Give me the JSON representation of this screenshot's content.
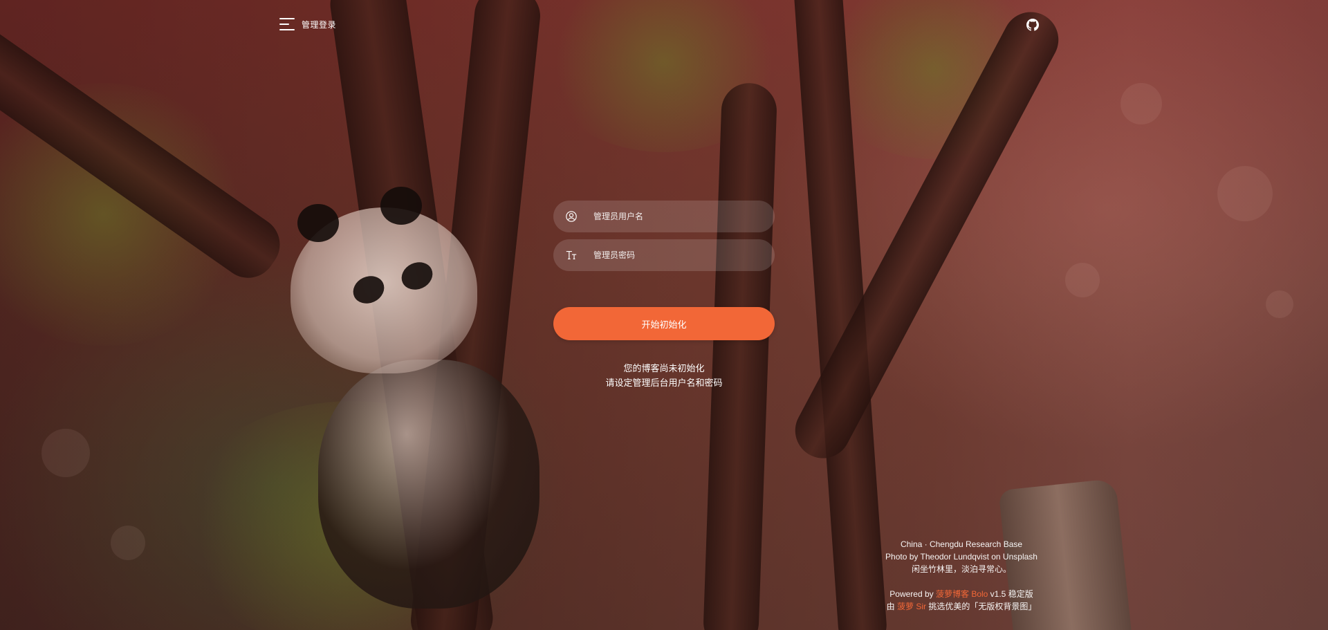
{
  "header": {
    "menu_label": "管理登录",
    "github_icon": "github-icon"
  },
  "form": {
    "username_placeholder": "管理员用户名",
    "password_placeholder": "管理员密码",
    "username_icon": "user-circle-icon",
    "password_icon": "text-tt-icon",
    "submit_label": "开始初始化",
    "notice_line1": "您的博客尚未初始化",
    "notice_line2": "请设定管理后台用户名和密码"
  },
  "footer": {
    "location": "China · Chengdu Research Base",
    "photo_credit": "Photo by Theodor Lundqvist on Unsplash",
    "motto": "闲坐竹林里，淡泊寻常心。",
    "powered_prefix": "Powered by ",
    "powered_link": "菠萝博客 Bolo",
    "powered_suffix": " v1.5 稳定版",
    "curated_prefix": "由 ",
    "curated_link": "菠萝 Sir",
    "curated_suffix": " 挑选优美的「无版权背景图」"
  },
  "colors": {
    "accent": "#f26737",
    "text": "#ffffff",
    "input_bg": "rgba(255,255,255,0.14)"
  }
}
